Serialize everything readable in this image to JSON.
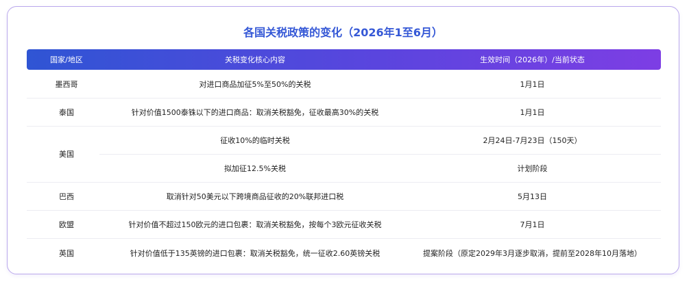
{
  "title": "各国关税政策的变化（2026年1至6月）",
  "table": {
    "headers": [
      "国家/地区",
      "关税变化核心内容",
      "生效时间（2026年）/当前状态"
    ],
    "rows": [
      {
        "country": "墨西哥",
        "change": "对进口商品加征5%至50%的关税",
        "status": "1月1日"
      },
      {
        "country": "泰国",
        "change": "针对价值1500泰铢以下的进口商品：取消关税豁免，征收最高30%的关税",
        "status": "1月1日"
      },
      {
        "country": "美国",
        "change": "征收10%的临时关税",
        "status": "2月24日-7月23日（150天）"
      },
      {
        "country": "",
        "change": "拟加征12.5%关税",
        "status": "计划阶段"
      },
      {
        "country": "巴西",
        "change": "取消针对50美元以下跨境商品征收的20%联邦进口税",
        "status": "5月13日"
      },
      {
        "country": "欧盟",
        "change": "针对价值不超过150欧元的进口包裹：取消关税豁免，按每个3欧元征收关税",
        "status": "7月1日"
      },
      {
        "country": "英国",
        "change": "针对价值低于135英镑的进口包裹：取消关税豁免，统一征收2.60英镑关税",
        "status": "提案阶段（原定2029年3月逐步取消，提前至2028年10月落地）"
      }
    ]
  }
}
